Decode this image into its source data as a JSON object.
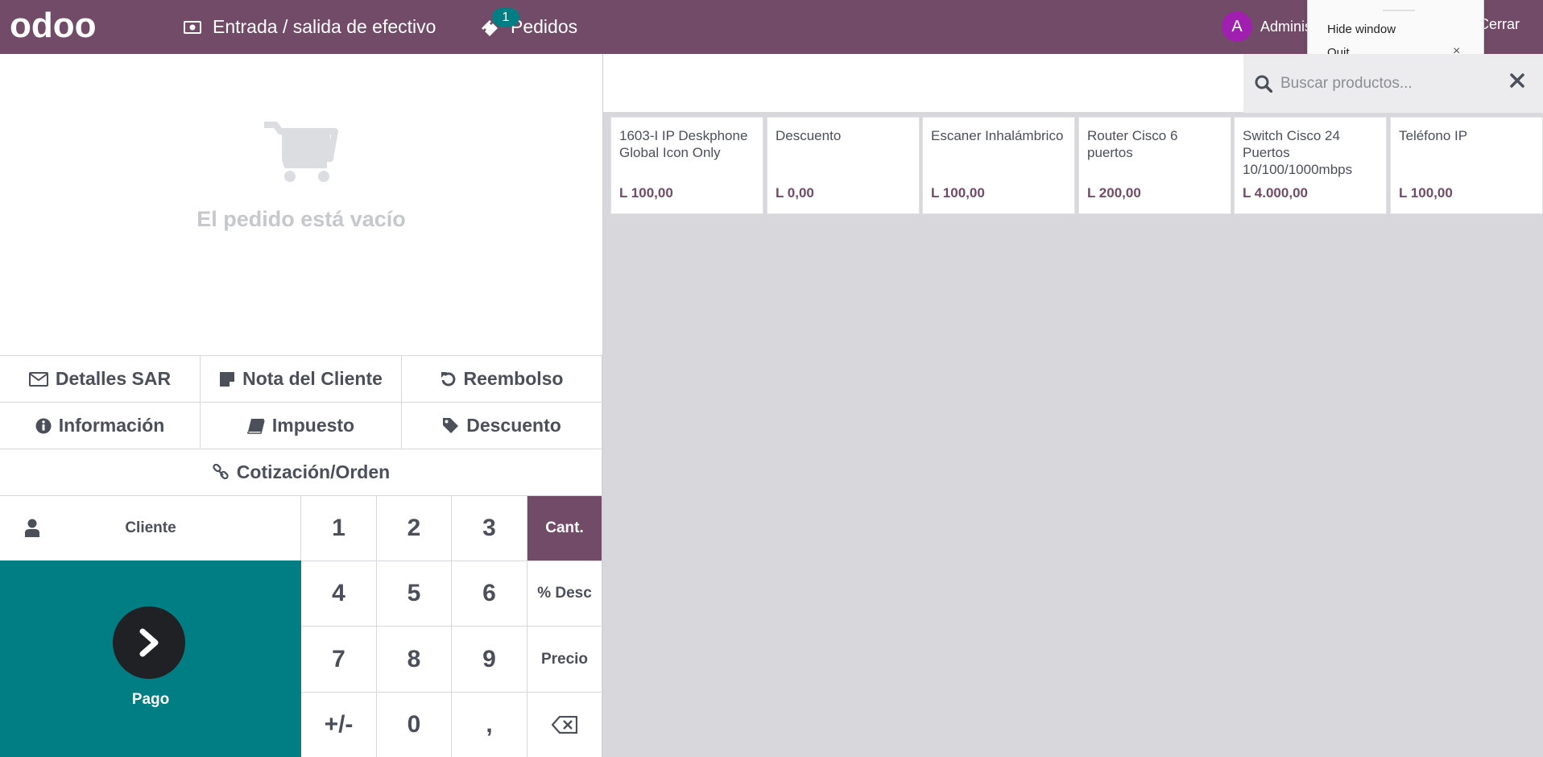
{
  "header": {
    "logo_text": "odoo",
    "cash_label": "Entrada / salida de efectivo",
    "orders_label": "Pedidos",
    "orders_count": "1",
    "user_initial": "A",
    "user_name": "Adminis",
    "close_label": "Cerrar",
    "color": "#714b67"
  },
  "popup": {
    "hide_label": "Hide window",
    "quit_label": "Quit",
    "close_glyph": "×"
  },
  "order": {
    "empty_text": "El pedido está vacío"
  },
  "controls": {
    "sar_details": "Detalles SAR",
    "customer_note": "Nota del Cliente",
    "refund": "Reembolso",
    "info": "Información",
    "tax": "Impuesto",
    "discount": "Descuento",
    "quotation": "Cotización/Orden"
  },
  "numpad": {
    "customer_label": "Cliente",
    "pay_label": "Pago",
    "keys": [
      "1",
      "2",
      "3",
      "4",
      "5",
      "6",
      "7",
      "8",
      "9",
      "+/-",
      "0",
      ","
    ],
    "modes": [
      "Cant.",
      "% Desc",
      "Precio"
    ],
    "active_mode": "Cant."
  },
  "search": {
    "placeholder": "Buscar productos..."
  },
  "products": [
    {
      "name": "1603-I IP Deskphone Global Icon Only",
      "price": "L 100,00"
    },
    {
      "name": "Descuento",
      "price": "L 0,00"
    },
    {
      "name": "Escaner Inhalámbrico",
      "price": "L 100,00"
    },
    {
      "name": "Router Cisco 6 puertos",
      "price": "L 200,00"
    },
    {
      "name": "Switch Cisco 24 Puertos 10/100/1000mbps",
      "price": "L 4.000,00"
    },
    {
      "name": "Teléfono IP",
      "price": "L 100,00"
    }
  ],
  "colors": {
    "brand": "#714b67",
    "pay": "#017e84",
    "badge": "#017e84"
  }
}
